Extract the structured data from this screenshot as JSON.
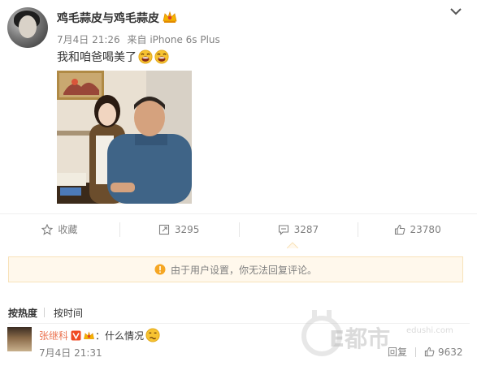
{
  "post": {
    "username": "鸡毛蒜皮与鸡毛蒜皮",
    "date": "7月4日 21:26",
    "source": "来自 iPhone 6s Plus",
    "text": "我和咱爸喝美了"
  },
  "actions": {
    "favorite": "收藏",
    "repost": "3295",
    "comment": "3287",
    "like": "23780"
  },
  "notice": "由于用户设置，你无法回复评论。",
  "sort": {
    "hot": "按热度",
    "time": "按时间"
  },
  "comment": {
    "user": "张继科",
    "text": "：什么情况",
    "time": "7月4日 21:31",
    "reply": "回复",
    "likes": "9632"
  },
  "watermark": {
    "text": "E都市",
    "sub": "edushi.com"
  },
  "colors": {
    "accent": "#eb7350",
    "notice_bg": "#fff8ec",
    "notice_border": "#f8e2b9",
    "muted": "#808080"
  }
}
